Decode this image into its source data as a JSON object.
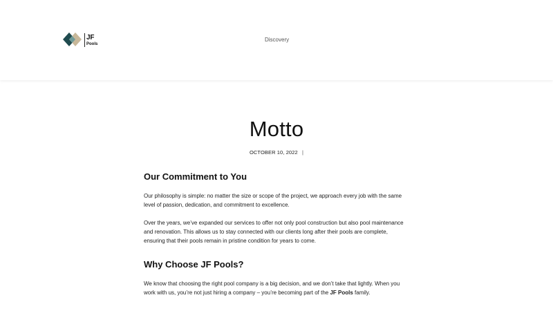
{
  "header": {
    "logo": {
      "line1": "JF",
      "line2": "Pools",
      "colors": [
        "#1f4b4f",
        "#6f9a98",
        "#c8b89a"
      ]
    },
    "nav": {
      "discovery_label": "Discovery"
    }
  },
  "post": {
    "title": "Motto",
    "date": "OCTOBER 10, 2022",
    "meta_separator": "|",
    "section1": {
      "heading": "Our Commitment to You",
      "p1": "Our philosophy is simple: no matter the size or scope of the project, we approach every job with the same level of passion, dedication, and commitment to excellence.",
      "p2": "Over the years, we’ve expanded our services to offer not only pool construction but also pool maintenance and renovation. This allows us to stay connected with our clients long after their pools are complete, ensuring that their pools remain in pristine condition for years to come."
    },
    "section2": {
      "heading": "Why Choose JF Pools?",
      "p1_before": "We know that choosing the right pool company is a big decision, and we don’t take that lightly. When you work with us, you’re not just hiring a company – you’re becoming part of the ",
      "p1_bold": "JF Pools",
      "p1_after": " family."
    }
  }
}
